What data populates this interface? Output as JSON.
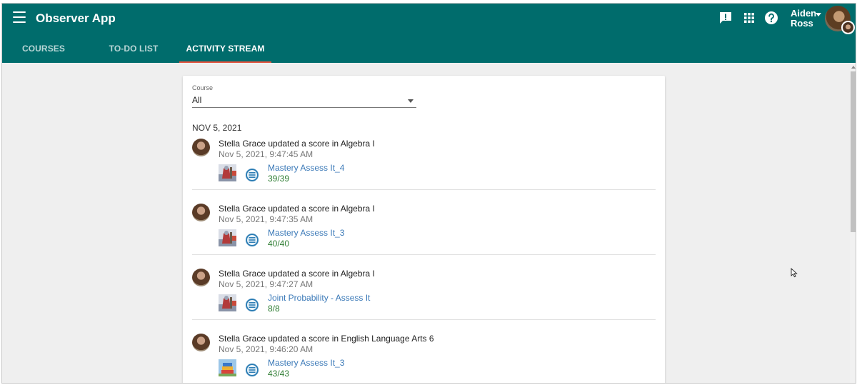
{
  "header": {
    "app_title": "Observer App",
    "user_first": "Aiden",
    "user_last": "Ross",
    "icons": [
      "menu-icon",
      "feedback-icon",
      "apps-grid-icon",
      "help-icon",
      "chevron-down-icon"
    ]
  },
  "tabs": [
    {
      "label": "COURSES",
      "active": false
    },
    {
      "label": "TO-DO LIST",
      "active": false
    },
    {
      "label": "ACTIVITY STREAM",
      "active": true
    }
  ],
  "filter": {
    "label": "Course",
    "value": "All"
  },
  "date_heading": "NOV 5, 2021",
  "activities": [
    {
      "text": "Stella Grace updated a score in Algebra I",
      "time": "Nov 5, 2021, 9:47:45 AM",
      "assignment": "Mastery Assess It_4",
      "score": "39/39",
      "course_icon": "knight-course-thumb"
    },
    {
      "text": "Stella Grace updated a score in Algebra I",
      "time": "Nov 5, 2021, 9:47:35 AM",
      "assignment": "Mastery Assess It_3",
      "score": "40/40",
      "course_icon": "knight-course-thumb"
    },
    {
      "text": "Stella Grace updated a score in Algebra I",
      "time": "Nov 5, 2021, 9:47:27 AM",
      "assignment": "Joint Probability - Assess It",
      "score": "8/8",
      "course_icon": "knight-course-thumb"
    },
    {
      "text": "Stella Grace updated a score in English Language Arts 6",
      "time": "Nov 5, 2021, 9:46:20 AM",
      "assignment": "Mastery Assess It_3",
      "score": "43/43",
      "course_icon": "books-course-thumb"
    }
  ],
  "colors": {
    "header_bg": "#006c6c",
    "tab_indicator": "#e5533d",
    "link": "#3c7ab8",
    "score": "#2e7d32",
    "page_bg": "#efefef"
  }
}
